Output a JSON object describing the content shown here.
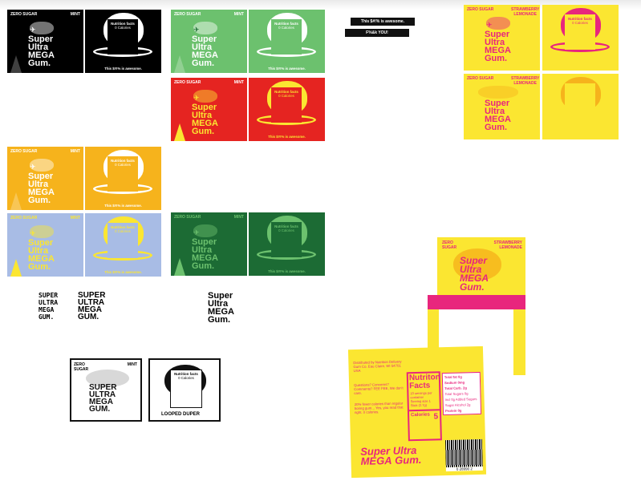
{
  "text": {
    "zero_sugar": "ZERO SUGAR",
    "mint": "MINT",
    "strawberry_lemonade": "STRAWBERRY LEMONADE",
    "product_name": "Super Ultra MEGA Gum.",
    "product_name_stacked": [
      "Super",
      "Ultra",
      "MEGA",
      "Gum."
    ],
    "nutrition_facts": "Nutrition facts",
    "calories_line": "0 Calories",
    "awesome_line": "This $#!% is awesome.",
    "label_1": "This $#!% is awesome.",
    "label_2": "F%&k YOU!",
    "logo_variant_1": [
      "SUPER",
      "ULTRA",
      "MEGA",
      "GUM."
    ],
    "logo_variant_2": [
      "SUPER",
      "ULTRA",
      "MEGA",
      "GUM."
    ],
    "caption_looped": "LOOPED DUPER"
  },
  "colors": {
    "black": "#000000",
    "green": "#6cc16e",
    "red": "#e52421",
    "orange": "#f6b31c",
    "lavender": "#a8bce5",
    "dark_green": "#1c6b34",
    "yellow": "#fbe631",
    "pink": "#e8267d"
  },
  "pack": {
    "front_product_name": "Super Ultra MEGA Gum.",
    "ingredients": "Distributed by Nutrition Delivery Gum Co. Eau Claire, WI 54701 USA",
    "questions": "Questions? Concerns? Comments? FEE FEE, We don't care.",
    "calories_claim": "20% fewer calories than regular boring gum... Yes, you read that right. 0 calories.",
    "nf_title": "Nutriton Facts",
    "servings": "10 servings per container",
    "serving_size": "Serving size 1 Stick (2.7g)",
    "calories_label": "Calories",
    "calories_value": "5",
    "total_fat": "Total fat 0g",
    "sodium": "Sodium 0mg",
    "total_carb": "Total Carb. 2g",
    "total_sugars": "Total Sugars 0g",
    "added_sugars": "Incl 0g Added Sugars",
    "sugar_alcohols": "Sugar Alcohol 2g",
    "protein": "Protein 0g",
    "barcode": "0 28990 2"
  }
}
